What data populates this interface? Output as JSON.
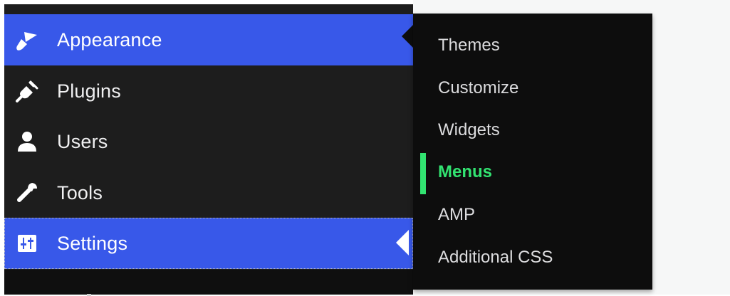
{
  "colors": {
    "sidebar_bg": "#1d1d1d",
    "active_bg": "#3858e9",
    "flyout_bg": "#0d0d0d",
    "current_accent": "#32e371",
    "content_bg": "#f6f7f7"
  },
  "sidebar": {
    "items": [
      {
        "label": "Appearance",
        "icon": "paintbrush-icon",
        "active": true
      },
      {
        "label": "Plugins",
        "icon": "plug-icon",
        "active": false
      },
      {
        "label": "Users",
        "icon": "user-icon",
        "active": false
      },
      {
        "label": "Tools",
        "icon": "wrench-icon",
        "active": false
      },
      {
        "label": "Settings",
        "icon": "settings-sliders-icon",
        "active": true
      }
    ]
  },
  "submenu": {
    "items": [
      {
        "label": "Themes",
        "current": false
      },
      {
        "label": "Customize",
        "current": false
      },
      {
        "label": "Widgets",
        "current": false
      },
      {
        "label": "Menus",
        "current": true
      },
      {
        "label": "AMP",
        "current": false
      },
      {
        "label": "Additional CSS",
        "current": false
      }
    ]
  }
}
